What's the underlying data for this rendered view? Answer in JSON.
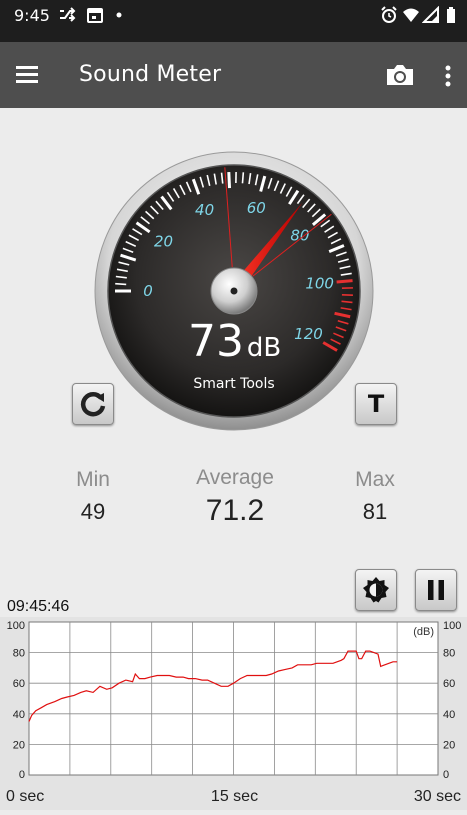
{
  "status_bar": {
    "time": "9:45",
    "left_icons": [
      "shuffle-icon",
      "calendar-icon",
      "dot-icon"
    ],
    "right_icons": [
      "alarm-icon",
      "wifi-icon",
      "signal-icon",
      "battery-icon"
    ]
  },
  "app_bar": {
    "title": "Sound Meter",
    "menu_icon": "hamburger-menu-icon",
    "camera_icon": "camera-icon",
    "overflow_icon": "more-vertical-icon"
  },
  "gauge": {
    "value": 73,
    "reading": "73",
    "unit": "dB",
    "brand": "Smart Tools",
    "min_marker": 49,
    "max_marker": 81,
    "scale_labels": [
      "0",
      "20",
      "40",
      "60",
      "80",
      "100",
      "120"
    ],
    "scale_min": 0,
    "scale_max": 120
  },
  "buttons": {
    "reset_icon": "refresh-icon",
    "t_label": "T",
    "brightness_icon": "brightness-icon",
    "pause_icon": "pause-icon"
  },
  "stats": {
    "min_label": "Min",
    "min_value": "49",
    "avg_label": "Average",
    "avg_value": "71.2",
    "max_label": "Max",
    "max_value": "81"
  },
  "graph": {
    "timestamp": "09:45:46",
    "unit_label": "(dB)",
    "y_ticks": [
      "100",
      "80",
      "60",
      "40",
      "20",
      "0"
    ],
    "x_ticks": [
      "0 sec",
      "15 sec",
      "30 sec"
    ],
    "line_color": "#e01010",
    "chart_data": {
      "type": "line",
      "x_range": [
        0,
        30
      ],
      "y_range": [
        0,
        100
      ],
      "x": [
        0,
        0.2,
        0.5,
        0.9,
        1.3,
        1.9,
        2.4,
        2.8,
        3.3,
        3.8,
        4.2,
        4.7,
        5.2,
        5.7,
        6.1,
        6.6,
        7.1,
        7.6,
        7.8,
        8.1,
        8.5,
        8.9,
        9.4,
        9.8,
        10.3,
        10.8,
        11.3,
        11.7,
        12.2,
        12.7,
        13.1,
        13.6,
        14.1,
        14.6,
        15.0,
        15.5,
        16.0,
        16.4,
        16.9,
        17.4,
        17.8,
        18.3,
        18.8,
        19.3,
        19.7,
        20.2,
        20.7,
        21.1,
        21.6,
        22.0,
        22.3,
        22.6,
        22.9,
        23.1,
        23.4,
        23.7,
        24.0,
        24.2,
        24.4,
        24.7,
        25.0,
        25.3,
        25.6,
        25.8,
        26.1,
        26.4,
        26.7,
        27.0
      ],
      "y": [
        35,
        39,
        42,
        44,
        46,
        48,
        50,
        51,
        52,
        54,
        55,
        54,
        58,
        56,
        57,
        60,
        62,
        61,
        66,
        63,
        63,
        64,
        65,
        65,
        65,
        64,
        64,
        63,
        63,
        62,
        62,
        60,
        58,
        58,
        60,
        63,
        65,
        65,
        65,
        65,
        66,
        68,
        69,
        70,
        72,
        72,
        72,
        73,
        73,
        73,
        73,
        74,
        75,
        76,
        81,
        81,
        81,
        76,
        76,
        81,
        81,
        80,
        79,
        71,
        72,
        73,
        74,
        74
      ]
    }
  }
}
